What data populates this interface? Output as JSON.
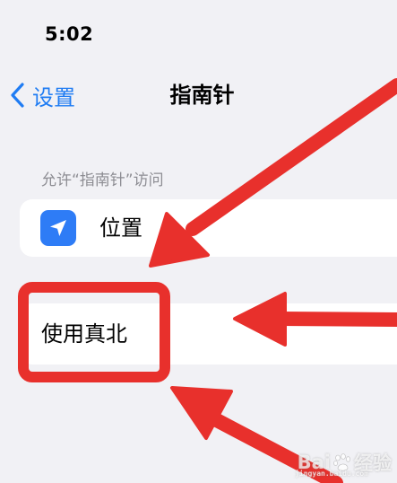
{
  "status_bar": {
    "time": "5:02"
  },
  "nav": {
    "back_label": "设置",
    "title": "指南针"
  },
  "section": {
    "header": "允许“指南针”访问"
  },
  "location_row": {
    "label": "位置",
    "icon": "location-arrow-icon"
  },
  "true_north_row": {
    "label": "使用真北"
  },
  "annotation": {
    "color": "#e8302c"
  },
  "colors": {
    "accent": "#1f7cf3",
    "background": "#f1f1f5",
    "location_icon_bg": "#2e7cf6"
  },
  "watermark": {
    "brand_left": "Bai",
    "brand_right": "经验",
    "domain": "jingyan.baidu.com"
  }
}
